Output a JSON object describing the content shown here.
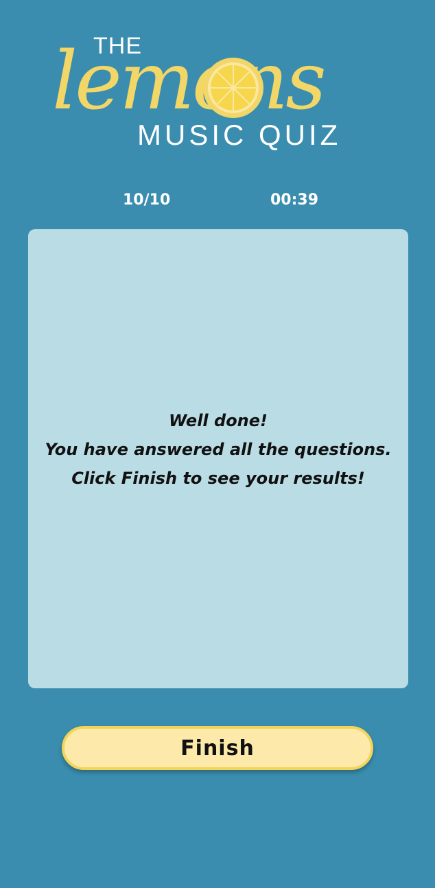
{
  "logo": {
    "the": "THE",
    "lemons": "lemons",
    "subtitle": "MUSIC QUIZ"
  },
  "stats": {
    "progress": "10/10",
    "timer": "00:39"
  },
  "message": {
    "line1": "Well done!",
    "line2": "You have answered all the questions.",
    "line3": "Click Finish to see your results!"
  },
  "finish_button": {
    "label": "Finish"
  },
  "colors": {
    "background": "#3a8dae",
    "card": "#badde5",
    "lemon_yellow": "#f2d668",
    "button_fill": "#fdeaaa",
    "button_border": "#f3d45a"
  },
  "icons": {
    "logo_o": "lemon-slice-icon"
  }
}
